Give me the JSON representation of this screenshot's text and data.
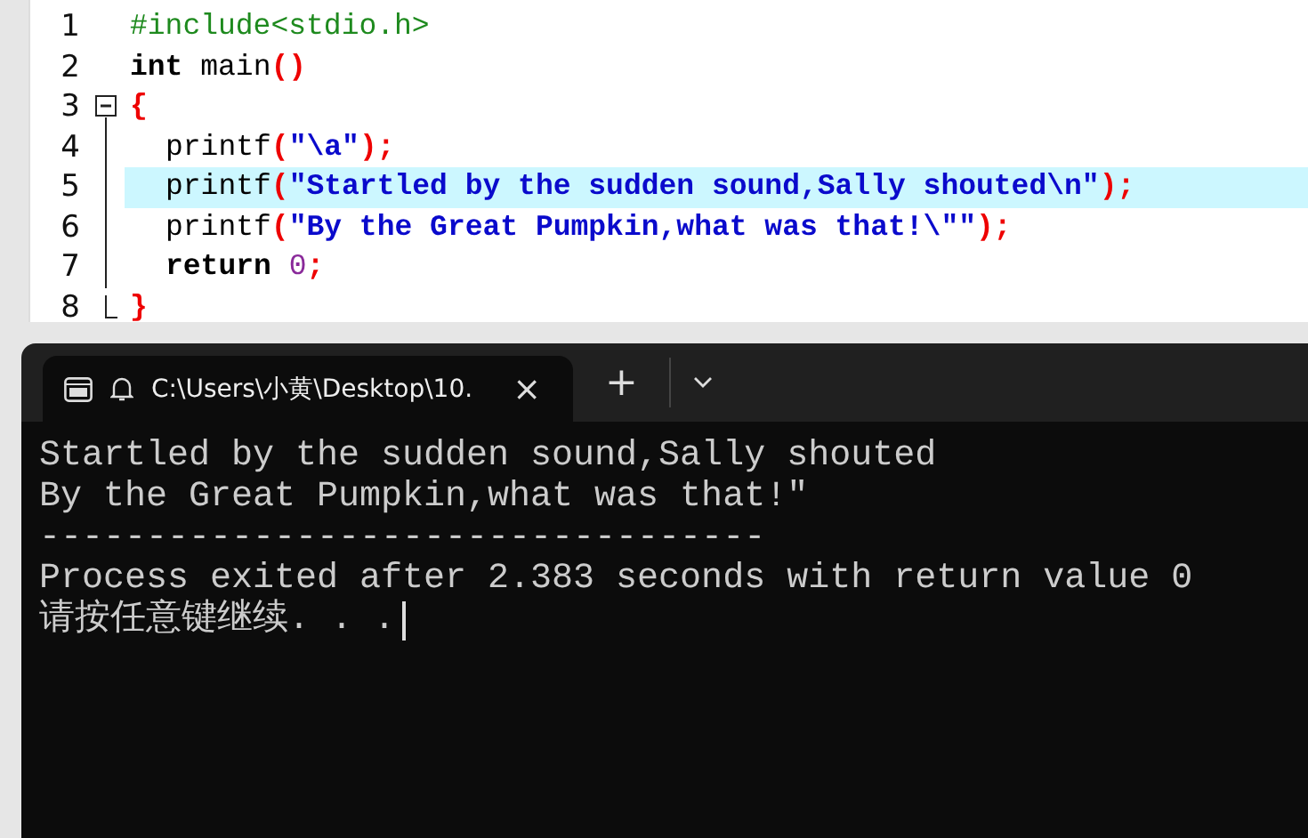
{
  "editor": {
    "lines": [
      {
        "number": "1",
        "highlighted": false,
        "indented": false,
        "kind": "plain",
        "tokens": [
          {
            "t": "#include<stdio.h>",
            "kind": "preproc"
          }
        ]
      },
      {
        "number": "2",
        "highlighted": false,
        "indented": false,
        "kind": "plain",
        "tokens": [
          {
            "t": "int",
            "kind": "keyword"
          },
          {
            "t": " main",
            "kind": "plain"
          },
          {
            "t": "()",
            "kind": "paren"
          }
        ]
      },
      {
        "number": "3",
        "highlighted": false,
        "indented": false,
        "kind": "fold_start",
        "tokens": [
          {
            "t": "{",
            "kind": "paren"
          }
        ]
      },
      {
        "number": "4",
        "highlighted": false,
        "indented": true,
        "kind": "fold_body",
        "tokens": [
          {
            "t": "printf",
            "kind": "plain"
          },
          {
            "t": "(",
            "kind": "paren"
          },
          {
            "t": "\"\\a\"",
            "kind": "string"
          },
          {
            "t": ");",
            "kind": "paren"
          }
        ]
      },
      {
        "number": "5",
        "highlighted": true,
        "indented": true,
        "kind": "fold_body",
        "tokens": [
          {
            "t": "printf",
            "kind": "plain"
          },
          {
            "t": "(",
            "kind": "paren"
          },
          {
            "t": "\"Startled by the sudden sound,Sally shouted\\n\"",
            "kind": "string"
          },
          {
            "t": ");",
            "kind": "paren"
          }
        ]
      },
      {
        "number": "6",
        "highlighted": false,
        "indented": true,
        "kind": "fold_body",
        "tokens": [
          {
            "t": "printf",
            "kind": "plain"
          },
          {
            "t": "(",
            "kind": "paren"
          },
          {
            "t": "\"By the Great Pumpkin,what was that!\\\"\"",
            "kind": "string"
          },
          {
            "t": ");",
            "kind": "paren"
          }
        ]
      },
      {
        "number": "7",
        "highlighted": false,
        "indented": true,
        "kind": "fold_body",
        "tokens": [
          {
            "t": "return ",
            "kind": "keyword"
          },
          {
            "t": "0",
            "kind": "number"
          },
          {
            "t": ";",
            "kind": "paren"
          }
        ]
      },
      {
        "number": "8",
        "highlighted": false,
        "indented": false,
        "kind": "fold_end",
        "tokens": [
          {
            "t": "}",
            "kind": "paren"
          }
        ]
      }
    ]
  },
  "terminal": {
    "tab": {
      "title": "C:\\Users\\小黄\\Desktop\\10.",
      "close": "×"
    },
    "new_tab": "+",
    "output": [
      "Startled by the sudden sound,Sally shouted",
      "By the Great Pumpkin,what was that!\"",
      "----------------------------------",
      "Process exited after 2.383 seconds with return value 0",
      "请按任意键继续. . ."
    ]
  }
}
